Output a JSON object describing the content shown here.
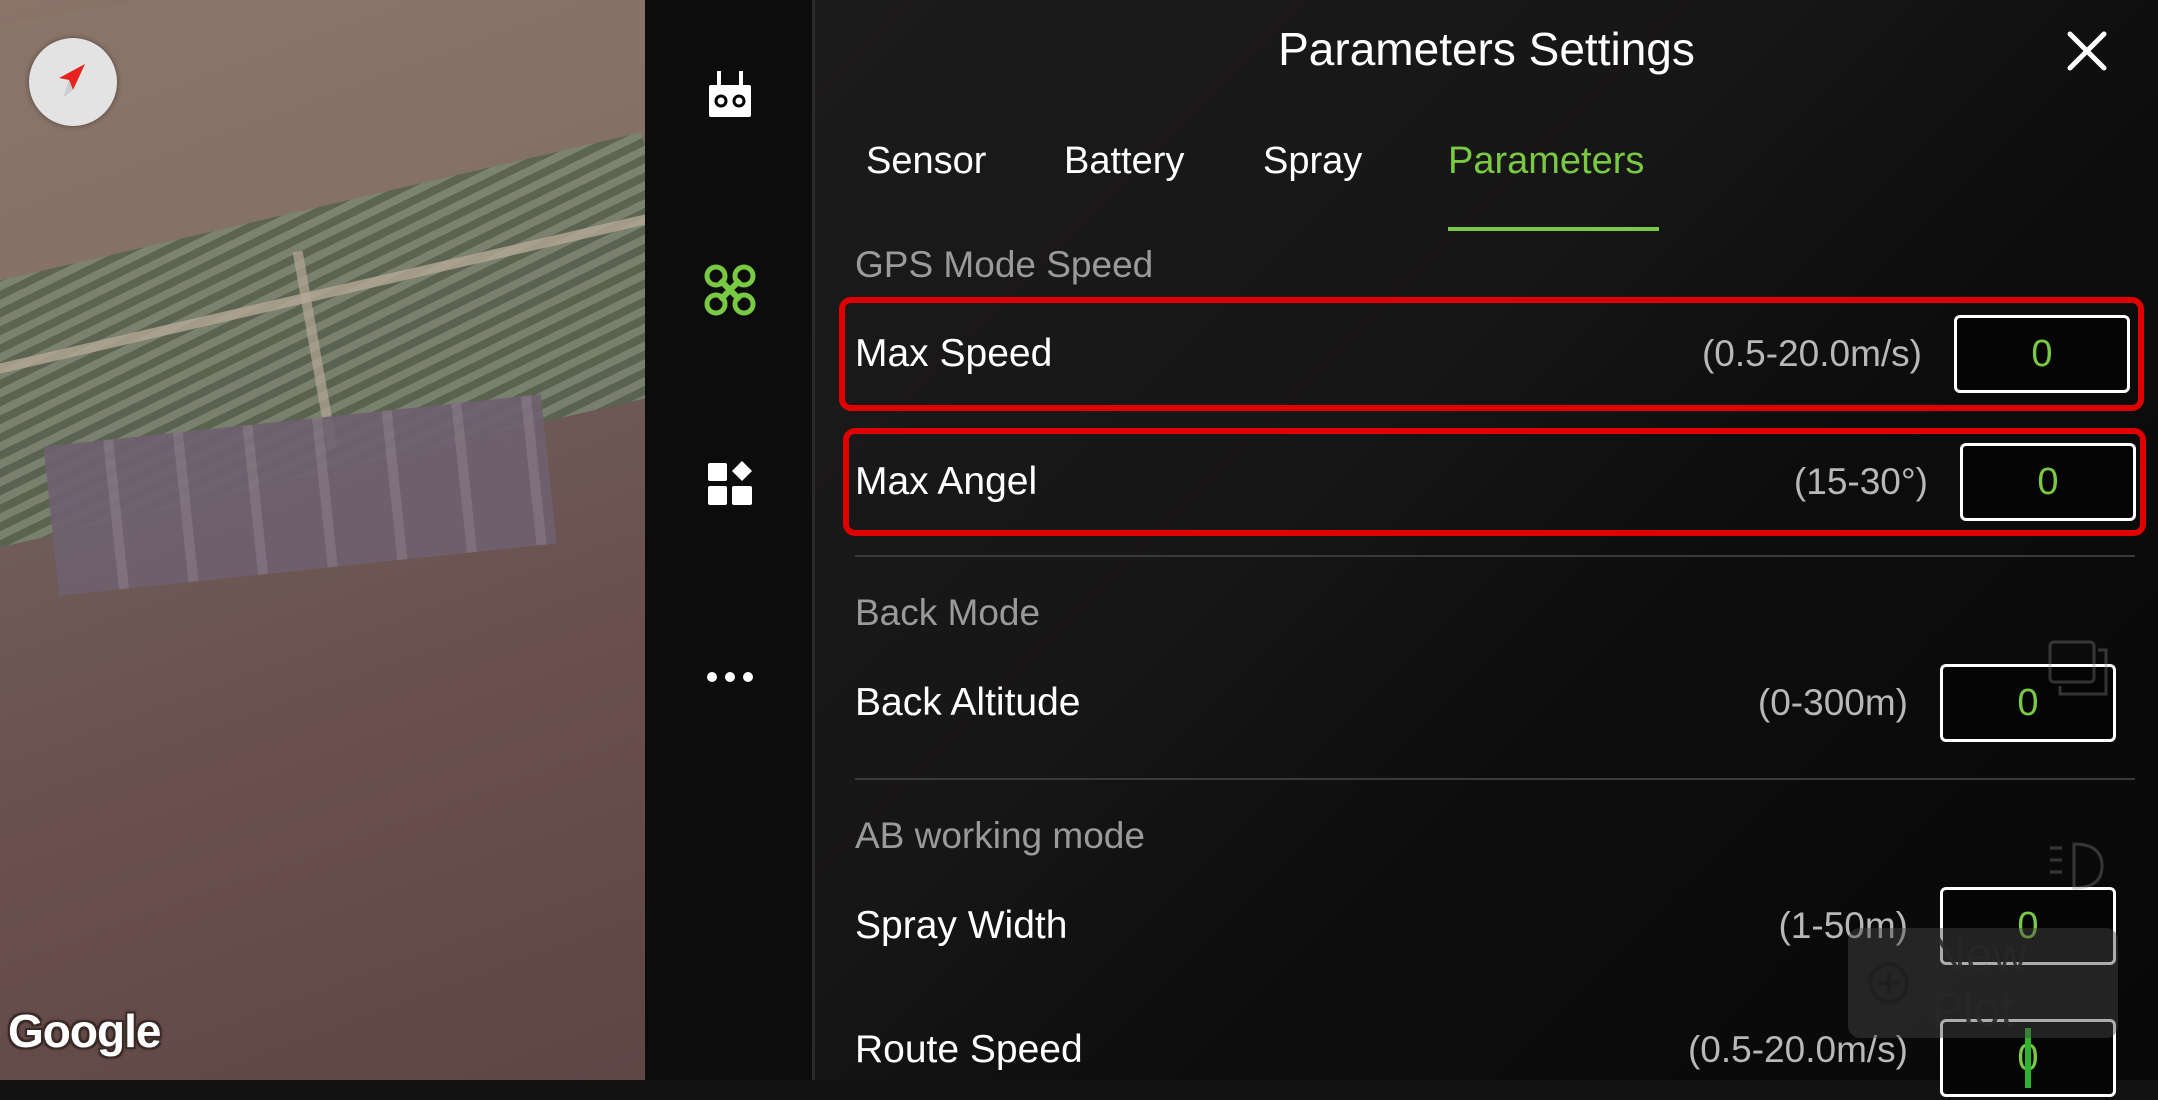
{
  "map": {
    "attribution": "Google",
    "compass_icon": "compass-arrow-icon"
  },
  "sidebar": {
    "items": [
      {
        "name": "remote-controller",
        "icon": "remote-controller-icon",
        "active": false
      },
      {
        "name": "drone",
        "icon": "drone-icon",
        "active": true
      },
      {
        "name": "apps",
        "icon": "apps-grid-icon",
        "active": false
      },
      {
        "name": "more",
        "icon": "more-dots-icon",
        "active": false
      }
    ]
  },
  "panel": {
    "title": "Parameters Settings",
    "close_icon": "close-icon",
    "tabs": [
      {
        "label": "Sensor",
        "active": false
      },
      {
        "label": "Battery",
        "active": false
      },
      {
        "label": "Spray",
        "active": false
      },
      {
        "label": "Parameters",
        "active": true
      }
    ],
    "sections": [
      {
        "title": "GPS Mode Speed",
        "rows": [
          {
            "label": "Max Speed",
            "range": "(0.5-20.0m/s)",
            "value": "0",
            "highlighted": true
          },
          {
            "label": "Max Angel",
            "range": "(15-30°)",
            "value": "0",
            "highlighted": true
          }
        ]
      },
      {
        "title": "Back Mode",
        "rows": [
          {
            "label": "Back Altitude",
            "range": "(0-300m)",
            "value": "0",
            "highlighted": false
          }
        ]
      },
      {
        "title": "AB working mode",
        "rows": [
          {
            "label": "Spray Width",
            "range": "(1-50m)",
            "value": "0",
            "highlighted": false
          },
          {
            "label": "Route Speed",
            "range": "(0.5-20.0m/s)",
            "value": "0",
            "highlighted": false,
            "focused": true
          }
        ]
      }
    ]
  },
  "overlay": {
    "new_plot_label": "New Plot",
    "new_plot_icon": "plus-circle-icon",
    "layers_icon": "layers-icon",
    "headlight_icon": "headlight-icon"
  },
  "colors": {
    "accent": "#7ac943",
    "highlight_border": "#e00000",
    "panel_bg": "#141414"
  }
}
